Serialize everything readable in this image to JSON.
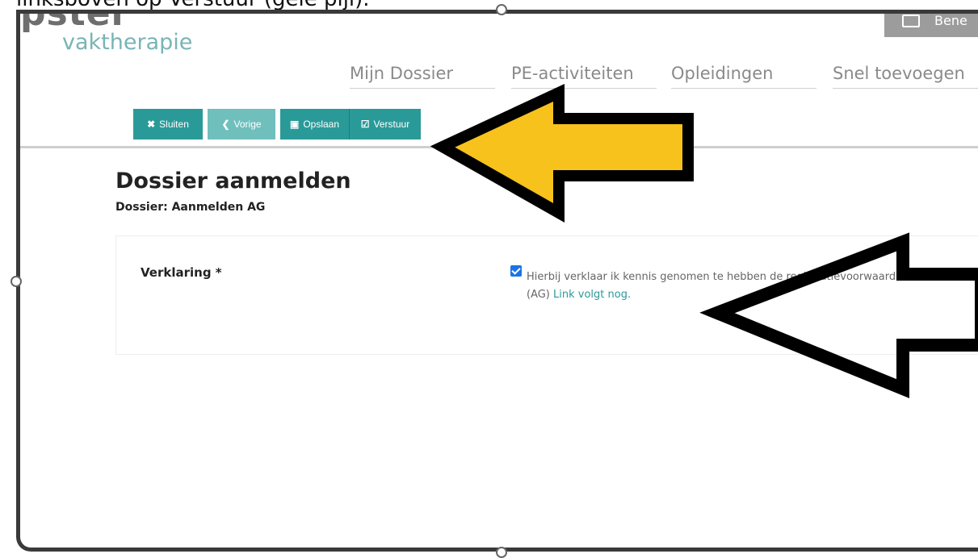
{
  "caption": "linksboven op Verstuur (gele pijl).",
  "logo": {
    "main": "pster",
    "sub": "vaktherapie"
  },
  "user": {
    "name": "Bene"
  },
  "nav": [
    {
      "label": "Mijn Dossier"
    },
    {
      "label": "PE-activiteiten"
    },
    {
      "label": "Opleidingen"
    },
    {
      "label": "Snel toevoegen"
    }
  ],
  "toolbar": {
    "close_label": "Sluiten",
    "prev_label": "Vorige",
    "save_label": "Opslaan",
    "send_label": "Verstuur"
  },
  "page": {
    "title": "Dossier aanmelden",
    "subtitle": "Dossier: Aanmelden AG"
  },
  "form": {
    "field_label": "Verklaring *",
    "checkbox_checked": true,
    "declaration_text": "Hierbij verklaar ik kennis genomen te hebben de registratievoorwaarden van de",
    "declaration_org": "(AG)",
    "declaration_link": "Link volgt nog."
  },
  "colors": {
    "accent": "#2a9a98",
    "accent_light": "#6fbfbd",
    "logo_teal": "#79b4b6",
    "arrow_yellow": "#f7c21c",
    "arrow_outline": "#000000"
  },
  "icons": {
    "close": "x-icon",
    "prev": "chevron-left-icon",
    "save": "floppy-icon",
    "send": "checkbox-icon"
  }
}
